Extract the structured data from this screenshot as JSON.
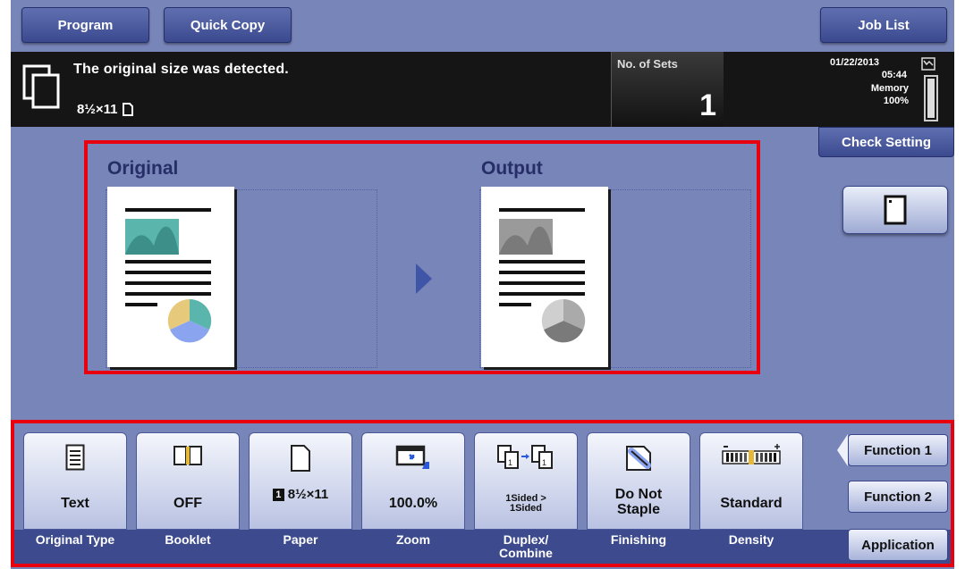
{
  "top_bar": {
    "program_label": "Program",
    "quick_copy_label": "Quick Copy",
    "job_list_label": "Job List"
  },
  "status": {
    "message": "The original size was detected.",
    "detected_size": "8½×11",
    "sets_label": "No. of Sets",
    "sets_value": "1"
  },
  "device": {
    "date": "01/22/2013",
    "time": "05:44",
    "memory_label": "Memory",
    "memory_value": "100%",
    "memory_fraction": 1.0
  },
  "right_panel": {
    "check_setting_label": "Check Setting"
  },
  "preview": {
    "original_title": "Original",
    "output_title": "Output",
    "colors": {
      "original_pie": [
        "#5ab5ad",
        "#e6c97a",
        "#8aa4f0"
      ],
      "output_pie": [
        "#aaaaaa",
        "#cfcfcf",
        "#7a7a7a"
      ]
    }
  },
  "functions": [
    {
      "value": "Text",
      "label": "Original Type",
      "icon": "text-document-icon"
    },
    {
      "value": "OFF",
      "label": "Booklet",
      "icon": "booklet-icon"
    },
    {
      "value": "8½×11",
      "tray": "1",
      "label": "Paper",
      "icon": "paper-icon"
    },
    {
      "value": "100.0%",
      "label": "Zoom",
      "icon": "zoom-icon"
    },
    {
      "value_line1": "1Sided >",
      "value_line2": "1Sided",
      "label_line1": "Duplex/",
      "label_line2": "Combine",
      "icon": "duplex-icon"
    },
    {
      "value_line1": "Do Not",
      "value_line2": "Staple",
      "label": "Finishing",
      "icon": "staple-icon"
    },
    {
      "value": "Standard",
      "label": "Density",
      "icon": "density-icon"
    }
  ],
  "side_buttons": {
    "function1": "Function 1",
    "function2": "Function 2",
    "application": "Application"
  },
  "accent": {
    "highlight_red": "#e8000e",
    "panel_blue": "#7885b9",
    "button_navy": "#3b4a8f"
  }
}
